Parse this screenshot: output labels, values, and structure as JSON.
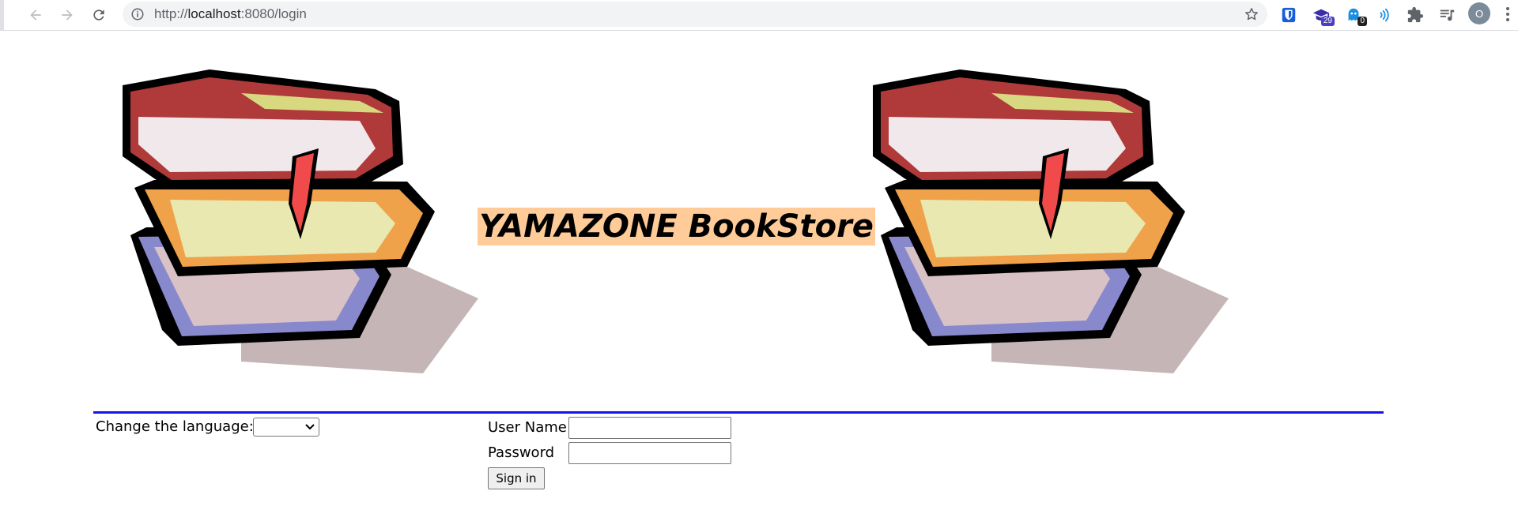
{
  "browser": {
    "url_host": "localhost",
    "url_rest": ":8080/login",
    "extensions": [
      {
        "name": "bitwarden-icon"
      },
      {
        "name": "graduation-cap-icon",
        "badge": "29",
        "badge_color": "#4a3fbf"
      },
      {
        "name": "ghost-icon",
        "badge": "0",
        "badge_color": "#222222"
      },
      {
        "name": "broadcast-icon"
      },
      {
        "name": "puzzle-icon"
      },
      {
        "name": "media-control-icon"
      }
    ],
    "avatar_letter": "O"
  },
  "page": {
    "title": "YAMAZONE BookStore",
    "title_bg": "#ffcc99",
    "divider_color": "#1515e6",
    "language_label": "Change the language:",
    "language_selected": "",
    "username_label": "User Name",
    "password_label": "Password",
    "username_value": "",
    "password_value": "",
    "sign_in_label": "Sign in"
  }
}
